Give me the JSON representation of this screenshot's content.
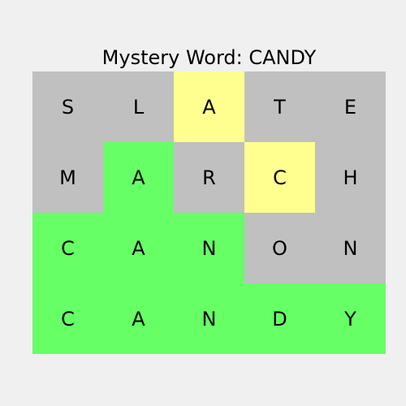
{
  "title": "Mystery Word: CANDY",
  "colors": {
    "absent": "#c0c0c0",
    "present": "#ffff90",
    "correct": "#66ff66",
    "background": "#f0f0f0"
  },
  "rows": [
    {
      "tiles": [
        {
          "letter": "S",
          "state": "absent"
        },
        {
          "letter": "L",
          "state": "absent"
        },
        {
          "letter": "A",
          "state": "present"
        },
        {
          "letter": "T",
          "state": "absent"
        },
        {
          "letter": "E",
          "state": "absent"
        }
      ]
    },
    {
      "tiles": [
        {
          "letter": "M",
          "state": "absent"
        },
        {
          "letter": "A",
          "state": "correct"
        },
        {
          "letter": "R",
          "state": "absent"
        },
        {
          "letter": "C",
          "state": "present"
        },
        {
          "letter": "H",
          "state": "absent"
        }
      ]
    },
    {
      "tiles": [
        {
          "letter": "C",
          "state": "correct"
        },
        {
          "letter": "A",
          "state": "correct"
        },
        {
          "letter": "N",
          "state": "correct"
        },
        {
          "letter": "O",
          "state": "absent"
        },
        {
          "letter": "N",
          "state": "absent"
        }
      ]
    },
    {
      "tiles": [
        {
          "letter": "C",
          "state": "correct"
        },
        {
          "letter": "A",
          "state": "correct"
        },
        {
          "letter": "N",
          "state": "correct"
        },
        {
          "letter": "D",
          "state": "correct"
        },
        {
          "letter": "Y",
          "state": "correct"
        }
      ]
    }
  ]
}
